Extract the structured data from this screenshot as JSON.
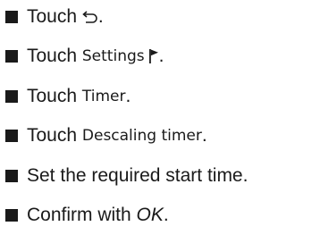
{
  "steps": [
    {
      "verb": "Touch",
      "icon": "back-arrow-icon",
      "end": "."
    },
    {
      "verb": "Touch",
      "term": "Settings",
      "icon": "flag-icon",
      "end": "."
    },
    {
      "verb": "Touch",
      "term": "Timer",
      "end": "."
    },
    {
      "verb": "Touch",
      "term": "Descaling timer",
      "end": "."
    },
    {
      "text": "Set the required start time."
    },
    {
      "prefix": "Confirm with",
      "term": "OK",
      "end": "."
    }
  ],
  "colors": {
    "text": "#1a1a1a",
    "background": "#ffffff"
  }
}
